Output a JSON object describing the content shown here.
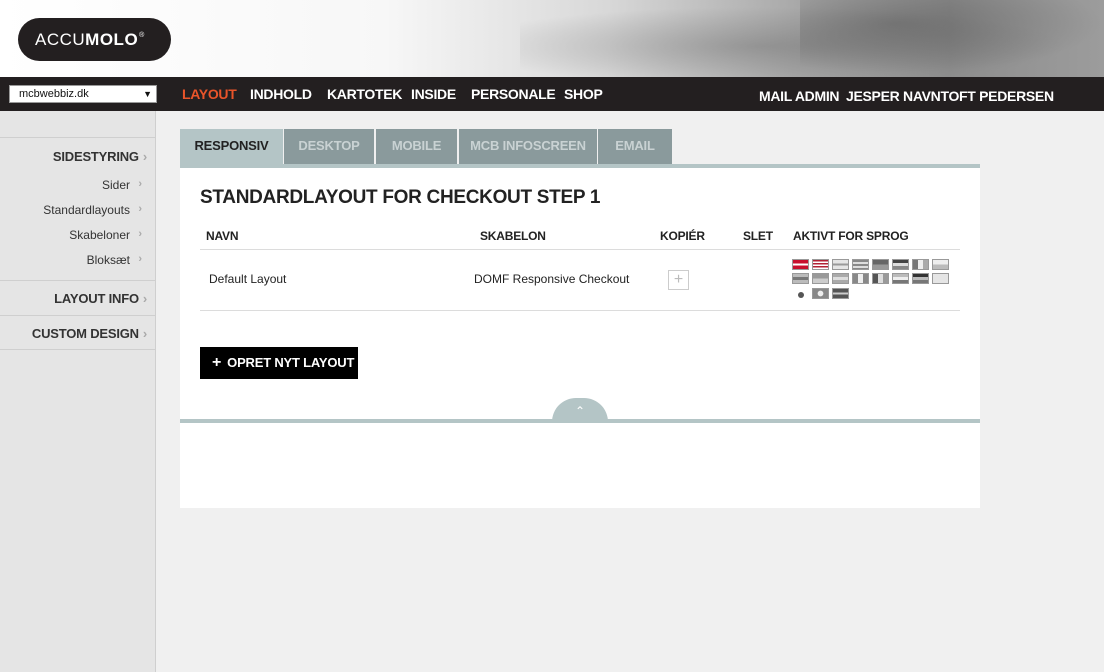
{
  "logo": {
    "light": "ACCU",
    "bold": "MOLO",
    "mark": "®"
  },
  "site_select": {
    "value": "mcbwebbiz.dk",
    "arrow": "▼"
  },
  "nav": {
    "items": [
      "LAYOUT",
      "INDHOLD",
      "KARTOTEK",
      "INSIDE",
      "PERSONALE",
      "SHOP"
    ],
    "right": [
      "MAIL ADMIN",
      "JESPER NAVNTOFT PEDERSEN"
    ]
  },
  "sidebar": {
    "sidestyring": "SIDESTYRING",
    "sub": [
      "Sider",
      "Standardlayouts",
      "Skabeloner",
      "Bloksæt"
    ],
    "layout_info": "LAYOUT INFO",
    "custom_design": "CUSTOM DESIGN",
    "chevron": "›"
  },
  "tabs": [
    "RESPONSIV",
    "DESKTOP",
    "MOBILE",
    "MCB INFOSCREEN",
    "EMAIL"
  ],
  "panel": {
    "title": "STANDARDLAYOUT FOR CHECKOUT STEP 1",
    "headers": {
      "navn": "NAVN",
      "skabelon": "SKABELON",
      "kopier": "KOPIÉR",
      "slet": "SLET",
      "aktivt": "AKTIVT FOR SPROG"
    },
    "row": {
      "navn": "Default Layout",
      "skabelon": "DOMF Responsive Checkout",
      "copy": "+"
    },
    "create_button": {
      "plus": "+",
      "label": "OPRET NYT LAYOUT"
    },
    "collapse": "⌃"
  },
  "colors": {
    "accent": "#e8542a",
    "tab": "#8a9a9c",
    "tab_active": "#b4c5c6",
    "dark": "#231f20"
  }
}
